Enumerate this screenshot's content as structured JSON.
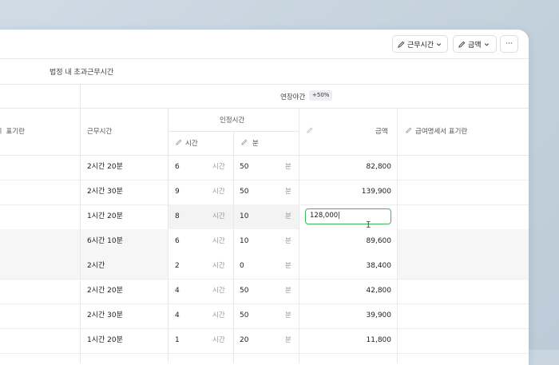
{
  "toolbar": {
    "work_time_label": "근무시간",
    "amount_label": "금액",
    "more_label": "···"
  },
  "subheader": {
    "title": "법정 내 초과근무시간"
  },
  "extended_night": {
    "label": "연장야간",
    "badge": "+50%"
  },
  "headers": {
    "left_partial": "ㅣ 표기란",
    "work_time": "근무시간",
    "recognized_time": "인정시간",
    "hours": "시간",
    "minutes": "분",
    "amount": "금액",
    "payslip_note": "급여명세서 표기란"
  },
  "units": {
    "hour": "시간",
    "minute": "분"
  },
  "rows": [
    {
      "work_time": "2시간 20분",
      "hours": "6",
      "minutes": "50",
      "amount": "82,800"
    },
    {
      "work_time": "2시간 30분",
      "hours": "9",
      "minutes": "50",
      "amount": "139,900"
    },
    {
      "work_time": "1시간 20분",
      "hours": "8",
      "minutes": "10",
      "amount": "128,000"
    },
    {
      "work_time": "6시간 10분",
      "hours": "6",
      "minutes": "10",
      "amount": "89,600"
    },
    {
      "work_time": "2시간",
      "hours": "2",
      "minutes": "0",
      "amount": "38,400"
    },
    {
      "work_time": "2시간 20분",
      "hours": "4",
      "minutes": "50",
      "amount": "42,800"
    },
    {
      "work_time": "2시간 30분",
      "hours": "4",
      "minutes": "50",
      "amount": "39,900"
    },
    {
      "work_time": "1시간 20분",
      "hours": "1",
      "minutes": "20",
      "amount": "11,800"
    }
  ],
  "editing_value": "128,000",
  "colors": {
    "accent_green": "#3fb55d",
    "border": "#e6e8eb"
  }
}
